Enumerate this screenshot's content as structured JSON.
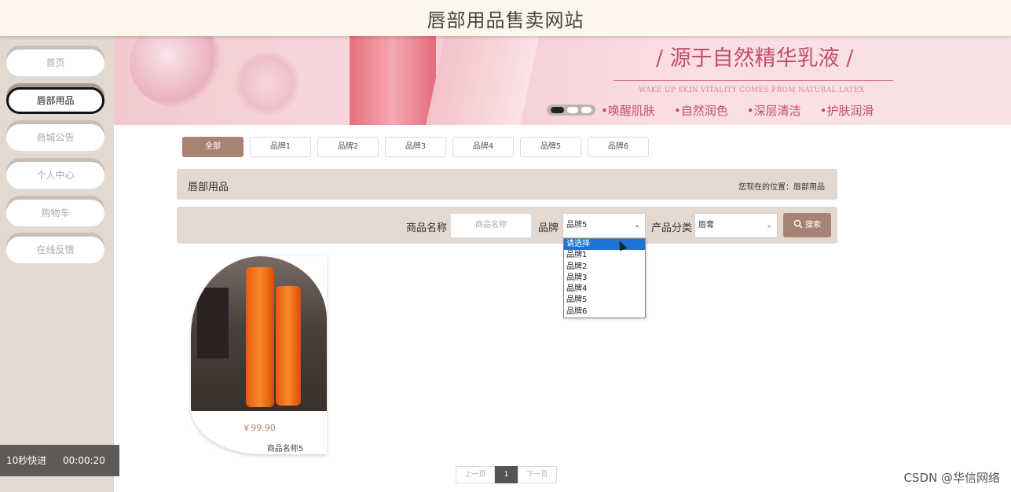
{
  "header": {
    "title": "唇部用品售卖网站"
  },
  "sidebar": {
    "items": [
      {
        "label": "首页",
        "active": false
      },
      {
        "label": "唇部用品",
        "active": true
      },
      {
        "label": "商城公告",
        "active": false
      },
      {
        "label": "个人中心",
        "active": false
      },
      {
        "label": "购物车",
        "active": false
      },
      {
        "label": "在线反馈",
        "active": false
      }
    ]
  },
  "banner": {
    "slogan": "/ 源于自然精华乳液 /",
    "slogan_en": "WAKE UP SKIN VITALITY COMES FROM NATURAL LATEX",
    "features": [
      "•唤醒肌肤",
      "•自然润色",
      "•深层清洁",
      "•护肤润滑"
    ]
  },
  "tabs": [
    "全部",
    "品牌1",
    "品牌2",
    "品牌3",
    "品牌4",
    "品牌5",
    "品牌6"
  ],
  "active_tab": "全部",
  "crumb": {
    "title": "唇部用品",
    "location": "您现在的位置：唇部用品"
  },
  "search": {
    "name_label": "商品名称",
    "name_placeholder": "商品名称",
    "brand_label": "品牌",
    "brand_value": "品牌5",
    "category_label": "产品分类",
    "category_value": "唇膏",
    "button_label": "搜索"
  },
  "brand_options": [
    "请选择",
    "品牌1",
    "品牌2",
    "品牌3",
    "品牌4",
    "品牌5",
    "品牌6"
  ],
  "highlighted_option": "请选择",
  "product": {
    "price": "￥99.90",
    "name": "商品名称5"
  },
  "pager": {
    "prev": "上一页",
    "current": "1",
    "next": "下一页"
  },
  "overlay": {
    "timer_label": "10秒快进",
    "timer_value": "00:00:20",
    "watermark": "CSDN @华信网络"
  },
  "colors": {
    "accent": "#a88374",
    "panel": "#e3d9d0",
    "header_bg": "#fdf6ea",
    "highlight": "#1e74d6"
  }
}
